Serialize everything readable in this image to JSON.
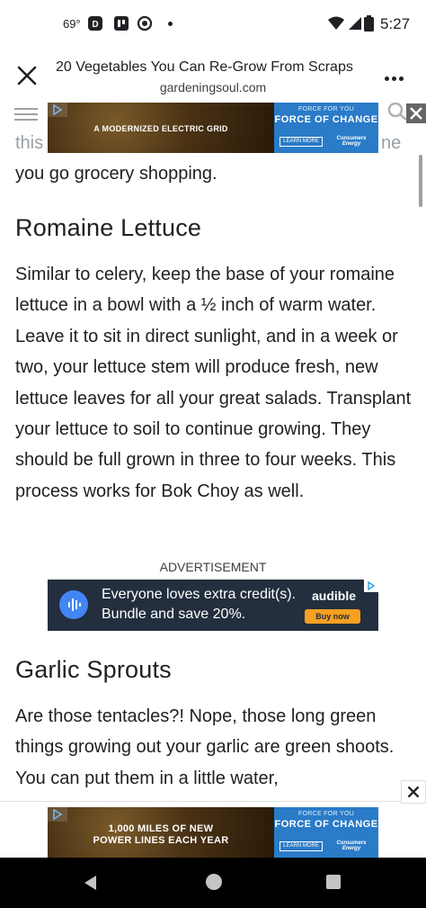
{
  "status_bar": {
    "temperature": "69°",
    "time": "5:27",
    "icons": [
      "disney-plus-icon",
      "app-icon",
      "record-icon",
      "notification-dot-icon",
      "wifi-icon",
      "signal-icon",
      "battery-icon"
    ]
  },
  "header": {
    "title": "20 Vegetables You Can Re-Grow From Scraps",
    "domain": "gardeningsoul.com"
  },
  "top_ad": {
    "photo_text": "A MODERNIZED ELECTRIC GRID",
    "tagline_small": "FORCE FOR YOU",
    "tagline_big": "FORCE OF CHANGE",
    "cta": "LEARN MORE",
    "brand": "Consumers Energy"
  },
  "article": {
    "peek_left": "this",
    "peek_right": "ne",
    "intro_end": "you go grocery shopping.",
    "sections": [
      {
        "heading": "Romaine Lettuce",
        "body": "Similar to celery, keep the base of your romaine lettuce in a bowl with a ½ inch of warm water. Leave it to sit in direct sunlight, and in a week or two, your lettuce stem will produce fresh, new lettuce leaves for all your great salads. Transplant your lettuce to soil to continue growing. They should be full grown in three to four weeks. This process works for Bok Choy as well."
      },
      {
        "heading": "Garlic Sprouts",
        "body": "Are those tentacles?! Nope, those long green things growing out your garlic are green shoots. You can put them in a little water,"
      }
    ]
  },
  "advertisement_label": "ADVERTISEMENT",
  "audible_ad": {
    "line1": "Everyone loves extra credit(s).",
    "line2": "Bundle and save 20%.",
    "brand": "audible",
    "cta": "Buy now"
  },
  "bottom_ad": {
    "photo_text_1": "1,000 MILES OF NEW",
    "photo_text_2": "POWER LINES EACH YEAR",
    "tagline_small": "FORCE FOR YOU",
    "tagline_big": "FORCE OF CHANGE",
    "cta": "LEARN MORE",
    "brand": "Consumers Energy"
  },
  "colors": {
    "ad_blue": "#2a7bc8",
    "audible_bg": "#232f3e",
    "audible_orange": "#f7a021",
    "text": "#202124"
  }
}
